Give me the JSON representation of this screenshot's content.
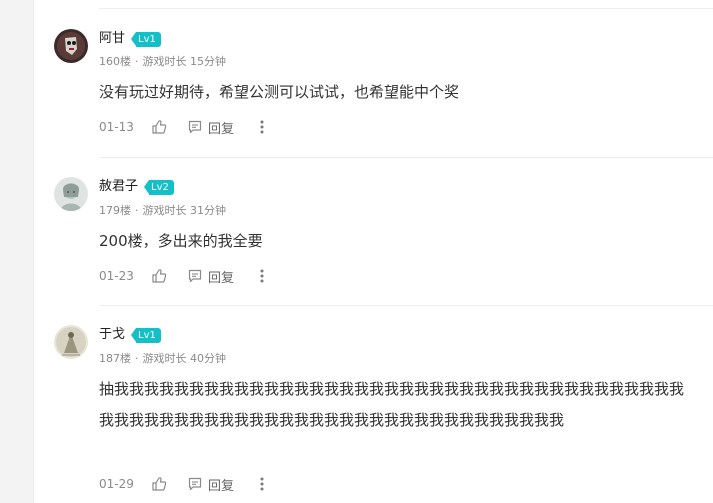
{
  "comments": [
    {
      "username": "阿甘",
      "level": "Lv1",
      "floor": "160楼",
      "playtime": "游戏时长 15分钟",
      "content": "没有玩过好期待，希望公测可以试试，也希望能中个奖",
      "date": "01-13",
      "reply_label": "回复"
    },
    {
      "username": "赦君子",
      "level": "Lv2",
      "floor": "179楼",
      "playtime": "游戏时长 31分钟",
      "content": "200楼，多出来的我全要",
      "date": "01-23",
      "reply_label": "回复"
    },
    {
      "username": "于戈",
      "level": "Lv1",
      "floor": "187楼",
      "playtime": "游戏时长 40分钟",
      "content": "抽我我我我我我我我我我我我我我我我我我我我我我我我我我我我我我我我我我我我我我我我我我我我我我我我我我我我我我我我我我我我我我我我我我我我我",
      "date": "01-29",
      "reply_label": "回复"
    }
  ],
  "meta_separator": "·",
  "colors": {
    "level_badge": "#14c0c8",
    "meta_text": "#8a8a8a",
    "content_text": "#333333"
  },
  "icons": {
    "like": "thumb-up-icon",
    "reply": "comment-bubble-icon",
    "more": "more-vertical-icon"
  }
}
